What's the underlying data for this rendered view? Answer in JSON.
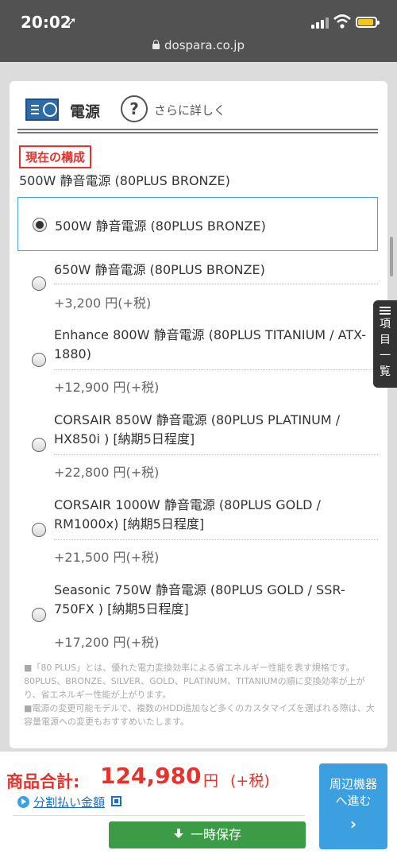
{
  "status_bar": {
    "time": "20:02",
    "url": "dospara.co.jp"
  },
  "section": {
    "title": "電源",
    "help_link": "さらに詳しく"
  },
  "current": {
    "badge": "現在の構成",
    "value": "500W 静音電源 (80PLUS BRONZE)"
  },
  "selected_option": {
    "name": "500W 静音電源 (80PLUS BRONZE)"
  },
  "options": [
    {
      "name": "650W 静音電源 (80PLUS BRONZE)",
      "price": "+3,200 円(+税)"
    },
    {
      "name": "Enhance 800W 静音電源 (80PLUS TITANIUM / ATX-1880)",
      "price": "+12,900 円(+税)"
    },
    {
      "name": "CORSAIR 850W 静音電源 (80PLUS PLATINUM / HX850i ) [納期5日程度]",
      "price": "+22,800 円(+税)"
    },
    {
      "name": "CORSAIR 1000W 静音電源 (80PLUS GOLD / RM1000x) [納期5日程度]",
      "price": "+21,500 円(+税)"
    },
    {
      "name": "Seasonic 750W 静音電源 (80PLUS GOLD / SSR-750FX ) [納期5日程度]",
      "price": "+17,200 円(+税)"
    }
  ],
  "notes": [
    "■「80 PLUS」とは、優れた電力変換効率による省エネルギー性能を表す規格です。80PLUS、BRONZE、SILVER、GOLD、PLATINUM、TITANIUMの順に変換効率が上がり、省エネルギー性能が上がります。",
    "■電源の変更可能モデルで、複数のHDD追加など多くのカスタマイズを選ばれる際は、大容量電源への変更もおすすめいたします。"
  ],
  "side_tab": {
    "line1": "項",
    "line2": "目",
    "line3": "一",
    "line4": "覧"
  },
  "footer": {
    "total_label": "商品合計:",
    "total_value": "124,980",
    "total_unit": "円",
    "total_tax": "(+税)",
    "installment_link": "分割払い金額",
    "save_button": "一時保存",
    "next_button_line1": "周辺機器",
    "next_button_line2": "へ進む",
    "next_button_chevron": "›"
  },
  "colors": {
    "accent_red": "#e5322d",
    "link_blue": "#1d6fb8",
    "save_green": "#3c9b46",
    "next_blue": "#3b9fe0"
  }
}
